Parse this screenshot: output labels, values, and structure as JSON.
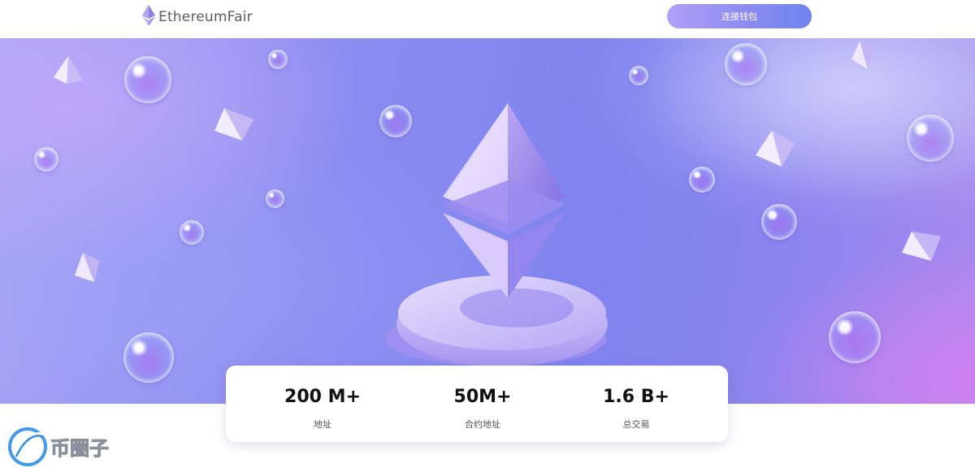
{
  "header": {
    "brand": "EthereumFair",
    "logo_icon": "ethereum-icon",
    "connect_wallet_label": "连接钱包"
  },
  "hero": {
    "illustration": "ethereum-3d-icon-on-pedestal",
    "decor": [
      "bubble",
      "crystal-gem"
    ]
  },
  "stats": [
    {
      "value": "200 M+",
      "label": "地址"
    },
    {
      "value": "50M+",
      "label": "合约地址"
    },
    {
      "value": "1.6 B+",
      "label": "总交易"
    }
  ],
  "watermark": {
    "text": "币圈子",
    "icon": "bquanzi-logo-icon"
  },
  "colors": {
    "button_start": "#b0a0f6",
    "button_end": "#6f83ee",
    "hero_primary": "#8b8cf0",
    "hero_accent": "#d680f0",
    "watermark_blue": "#2f8fe8"
  }
}
